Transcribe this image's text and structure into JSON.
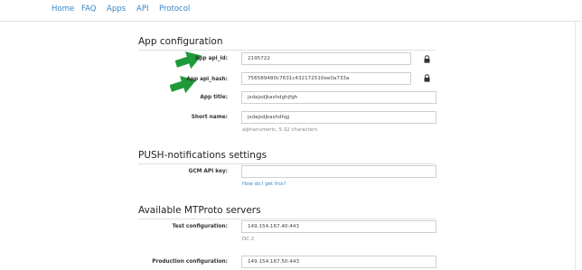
{
  "nav": {
    "items": [
      "Home",
      "FAQ",
      "Apps",
      "API",
      "Protocol"
    ]
  },
  "app_config": {
    "title": "App configuration",
    "api_id_label": "App api_id:",
    "api_id_value": "2195722",
    "api_hash_label": "App api_hash:",
    "api_hash_value": "756589480c7631c432172510ee0a733a",
    "app_title_label": "App title:",
    "app_title_value": "jsdajsdjkashdghjfgh",
    "short_name_label": "Short name:",
    "short_name_value": "jsdajsdjkashdhgj",
    "short_name_help": "alphanumeric, 5-32 characters"
  },
  "push": {
    "title": "PUSH-notifications settings",
    "gcm_label": "GCM API key:",
    "gcm_value": "",
    "gcm_help_link": "How do I get this?"
  },
  "servers": {
    "title": "Available MTProto servers",
    "test_label": "Test configuration:",
    "test_value": "149.154.167.40:443",
    "test_dc": "DC 2",
    "prod_label": "Production configuration:",
    "prod_value": "149.154.167.50:443"
  },
  "colors": {
    "link": "#3a86c5",
    "arrow": "#1f9a3a"
  },
  "icons": {
    "lock": "lock-icon",
    "arrow": "green-arrow-icon"
  }
}
